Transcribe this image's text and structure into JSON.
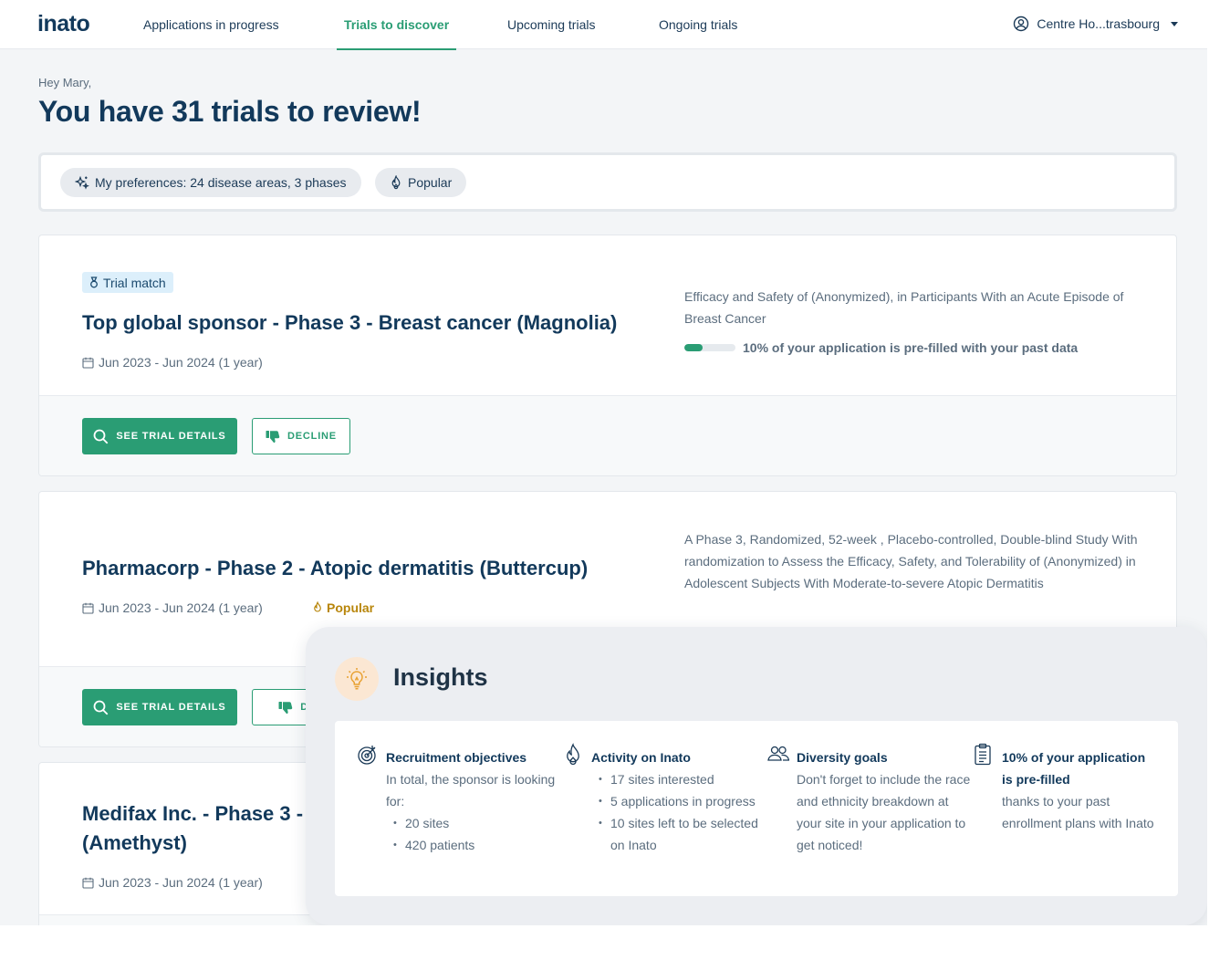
{
  "brand": {
    "logo": "inato",
    "accent": "#2a9d74"
  },
  "nav": {
    "tabs": [
      {
        "label": "Applications in progress",
        "active": false
      },
      {
        "label": "Trials to discover",
        "active": true
      },
      {
        "label": "Upcoming trials",
        "active": false
      },
      {
        "label": "Ongoing trials",
        "active": false
      }
    ],
    "center": "Centre Ho...trasbourg"
  },
  "page": {
    "greeting": "Hey Mary,",
    "headline": "You have 31 trials to review!"
  },
  "filters": {
    "preferences": "My preferences: 24 disease areas, 3 phases",
    "popular": "Popular"
  },
  "trials": [
    {
      "badge": "Trial match",
      "title": "Top global sponsor - Phase 3 - Breast cancer (Magnolia)",
      "dates": "Jun 2023 - Jun 2024 (1 year)",
      "description": "Efficacy and Safety of (Anonymized), in Participants With an Acute Episode of Breast Cancer",
      "prefill_text": "10% of your application is pre-filled with your past data",
      "prefill_fraction": 0.35,
      "details_label": "SEE TRIAL DETAILS",
      "decline_label": "DECLINE"
    },
    {
      "title": "Pharmacorp - Phase 2 - Atopic dermatitis (Buttercup)",
      "dates": "Jun 2023 - Jun 2024 (1 year)",
      "popular": "Popular",
      "description": "A Phase 3, Randomized, 52-week , Placebo-controlled, Double-blind Study With randomization to Assess the Efficacy, Safety, and Tolerability of (Anonymized) in Adolescent Subjects With Moderate-to-severe Atopic Dermatitis",
      "details_label": "SEE TRIAL DETAILS",
      "decline_label": "DEC"
    },
    {
      "title_line1": "Medifax Inc. - Phase 3 -",
      "title_line2": "(Amethyst)",
      "dates": "Jun 2023 - Jun 2024 (1 year)"
    }
  ],
  "insights": {
    "title": "Insights",
    "recruitment": {
      "heading": "Recruitment objectives",
      "intro": "In total, the sponsor is looking for:",
      "items": [
        "20 sites",
        "420 patients"
      ]
    },
    "activity": {
      "heading": "Activity on Inato",
      "items": [
        "17 sites interested",
        "5 applications in progress",
        "10 sites left to be selected on Inato"
      ]
    },
    "diversity": {
      "heading": "Diversity goals",
      "text": "Don't forget to include the race and ethnicity breakdown at your site in your application to get noticed!"
    },
    "prefilled": {
      "heading": "10% of your application is pre-filled",
      "text": "thanks to your past enrollment plans with Inato"
    }
  }
}
